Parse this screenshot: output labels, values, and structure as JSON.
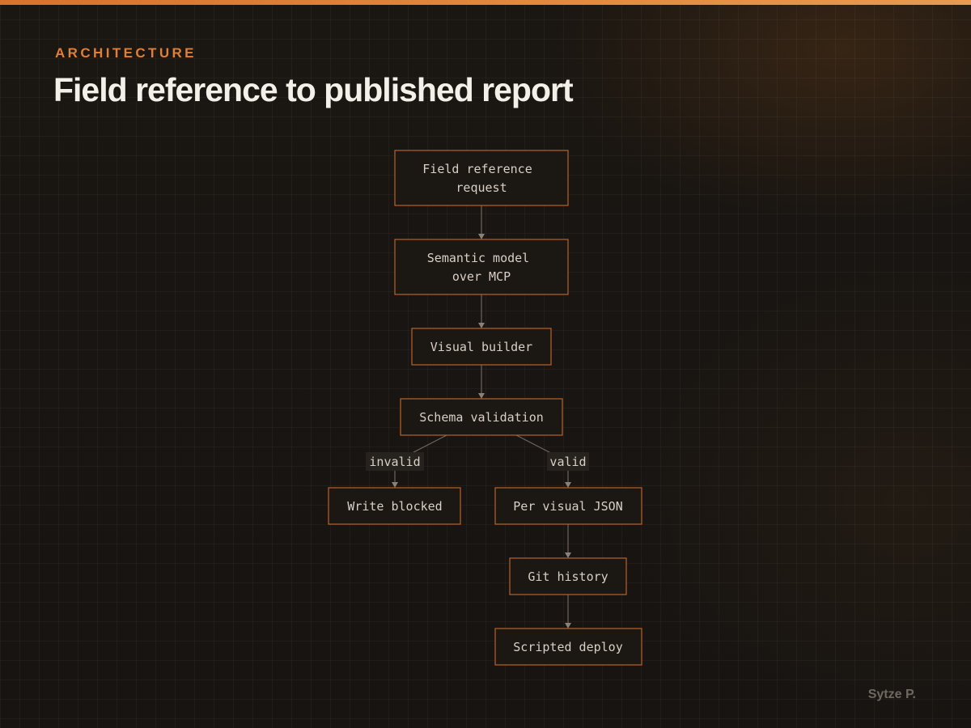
{
  "header": {
    "eyebrow": "ARCHITECTURE",
    "title": "Field reference to published report"
  },
  "diagram": {
    "nodes": {
      "field_request": [
        "Field reference",
        "request"
      ],
      "semantic_model": [
        "Semantic model",
        "over MCP"
      ],
      "visual_builder": [
        "Visual builder"
      ],
      "schema_validation": [
        "Schema validation"
      ],
      "write_blocked": [
        "Write blocked"
      ],
      "per_visual_json": [
        "Per visual JSON"
      ],
      "git_history": [
        "Git history"
      ],
      "scripted_deploy": [
        "Scripted deploy"
      ]
    },
    "edge_labels": {
      "invalid": "invalid",
      "valid": "valid"
    }
  },
  "footer": {
    "author": "Sytze P."
  },
  "colors": {
    "accent": "#e07f36",
    "node_border": "#b9622a",
    "background": "#161310"
  }
}
